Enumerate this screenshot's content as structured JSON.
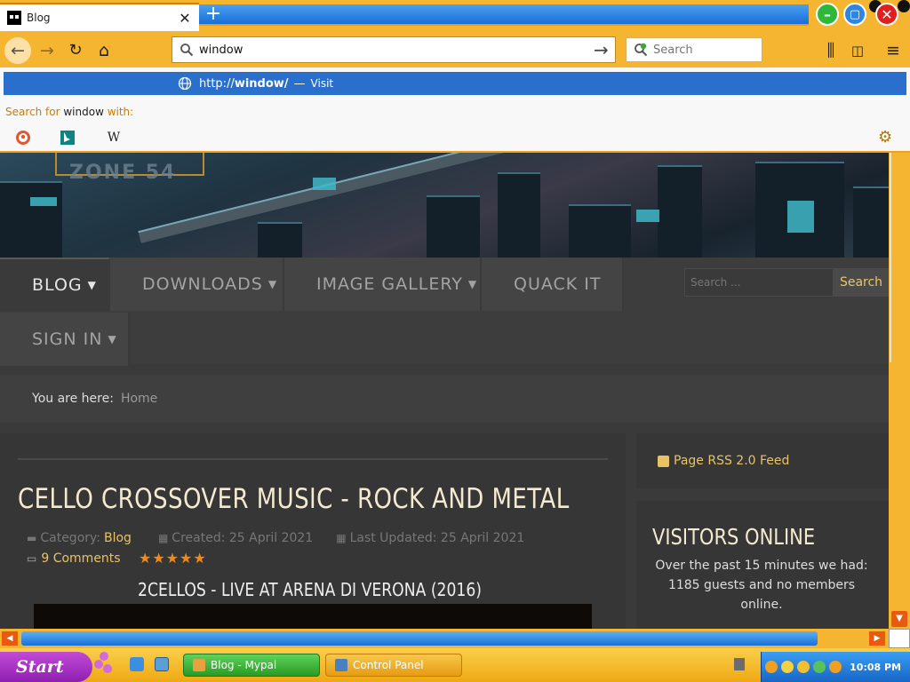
{
  "browser": {
    "tab": {
      "title": "Blog",
      "close_glyph": "✕"
    },
    "newtab_glyph": "+",
    "window_controls": {
      "minimize_glyph": "–",
      "maximize_glyph": "▢",
      "close_glyph": "✕"
    },
    "nav": {
      "back_glyph": "←",
      "forward_glyph": "→",
      "reload_glyph": "↻",
      "home_glyph": "⌂",
      "go_glyph": "→",
      "library_glyph": "⫼",
      "sidebar_glyph": "◫",
      "menu_glyph": "≡"
    },
    "urlbar": {
      "value": "window"
    },
    "searchbar": {
      "placeholder": "Search"
    },
    "autocomplete": {
      "url_prefix": "http://",
      "url_term": "window",
      "url_suffix": "/",
      "dash": "—",
      "visit_label": "Visit",
      "search_for_prefix": "Search for ",
      "search_term": "window",
      "search_for_suffix": " with:",
      "engines": [
        {
          "name": "duckduckgo-icon",
          "color": "#de5833"
        },
        {
          "name": "bing-icon",
          "color": "#0c8484"
        },
        {
          "name": "wikipedia-icon",
          "glyph": "W"
        }
      ],
      "settings_glyph": "⚙"
    },
    "accent_color": "#f5b530",
    "highlight_color": "#2a6fcb"
  },
  "site": {
    "logo_text": "ZONE 54",
    "menu": [
      {
        "label": "BLOG",
        "caret": "▼"
      },
      {
        "label": "DOWNLOADS",
        "caret": "▼"
      },
      {
        "label": "IMAGE GALLERY",
        "caret": "▼"
      },
      {
        "label": "QUACK IT"
      },
      {
        "label": "SIGN IN",
        "caret": "▼"
      }
    ],
    "search": {
      "placeholder": "Search ...",
      "button": "Search"
    },
    "breadcrumb": {
      "label": "You are here:",
      "home": "Home"
    },
    "article": {
      "title": "CELLO CROSSOVER MUSIC - ROCK AND METAL",
      "category_label": "Category:",
      "category": "Blog",
      "created": "Created: 25 April 2021",
      "updated": "Last Updated: 25 April 2021",
      "comments": "9 Comments",
      "rating_stars": "★★★★★",
      "subheading": "2CELLOS - LIVE AT ARENA DI VERONA (2016)"
    },
    "sidebar": {
      "rss": "Page RSS 2.0 Feed",
      "visitors_title": "VISITORS ONLINE",
      "visitors_text": "Over the past 15 minutes we had: 1185 guests and no members online."
    },
    "link_color": "#e8c366"
  },
  "scrollbars": {
    "up_glyph": "▲",
    "down_glyph": "▼",
    "left_glyph": "◀",
    "right_glyph": "▶"
  },
  "taskbar": {
    "start_label": "Start",
    "tasks": [
      {
        "label": "Blog - Mypal"
      },
      {
        "label": "Control Panel"
      }
    ],
    "clock": "10:08 PM"
  }
}
